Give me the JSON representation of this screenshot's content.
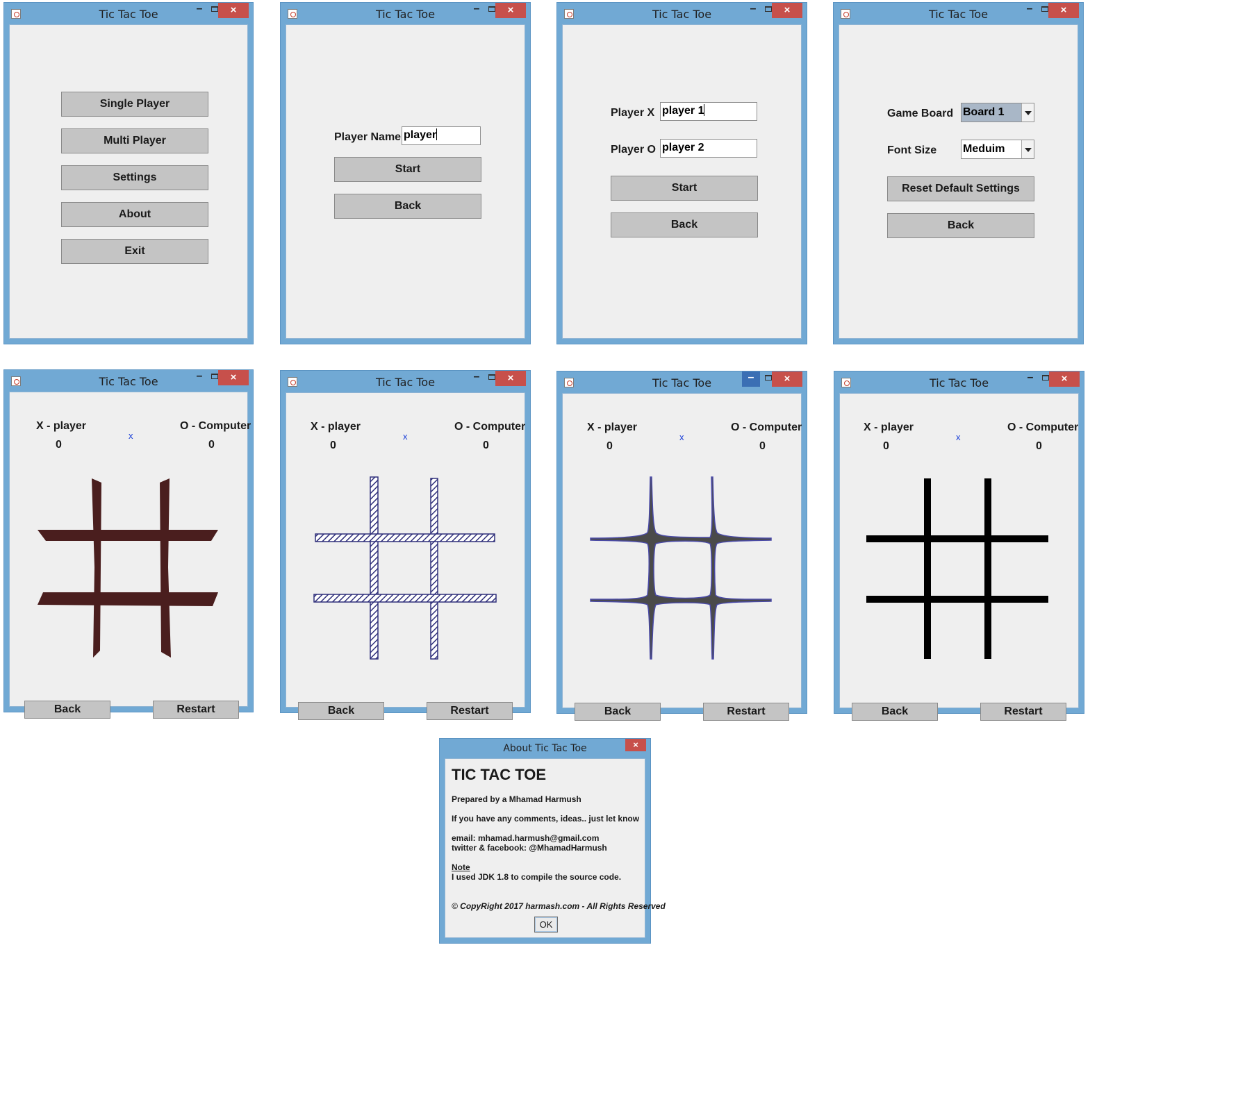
{
  "window_title": "Tic Tac Toe",
  "close_glyph": "×",
  "min_glyph": "–",
  "main_menu": {
    "buttons": [
      "Single Player",
      "Multi Player",
      "Settings",
      "About",
      "Exit"
    ]
  },
  "single_player": {
    "name_label": "Player Name",
    "name_value": "player",
    "start_label": "Start",
    "back_label": "Back"
  },
  "multi_player": {
    "x_label": "Player X",
    "x_value": "player 1",
    "o_label": "Player O",
    "o_value": "player 2",
    "start_label": "Start",
    "back_label": "Back"
  },
  "settings": {
    "board_label": "Game Board",
    "board_value": "Board 1",
    "font_label": "Font Size",
    "font_value": "Meduim",
    "reset_label": "Reset Default Settings",
    "back_label": "Back"
  },
  "game": {
    "x_player": "X - player",
    "o_player": "O - Computer",
    "x_score": "0",
    "o_score": "0",
    "turn": "x",
    "back_label": "Back",
    "restart_label": "Restart",
    "board_styles": [
      "brown-brush",
      "blue-sketch",
      "grey-rounded",
      "black-plain"
    ],
    "board_colors": [
      "#4a1e1e",
      "#2f2f7a",
      "#4a4a4a",
      "#000000"
    ]
  },
  "about": {
    "window_title": "About Tic Tac Toe",
    "heading": "TIC TAC TOE",
    "prepared_by": "Prepared by a Mhamad Harmush",
    "comments": "If you have any comments, ideas.. just let know",
    "email_line": "email:   mhamad.harmush@gmail.com",
    "social_line": "twitter & facebook:   @MhamadHarmush",
    "note_heading": "Note",
    "note_text": "I used JDK 1.8 to compile the source code.",
    "copyright": "© CopyRight 2017 harmash.com - All Rights Reserved",
    "ok_label": "OK"
  }
}
